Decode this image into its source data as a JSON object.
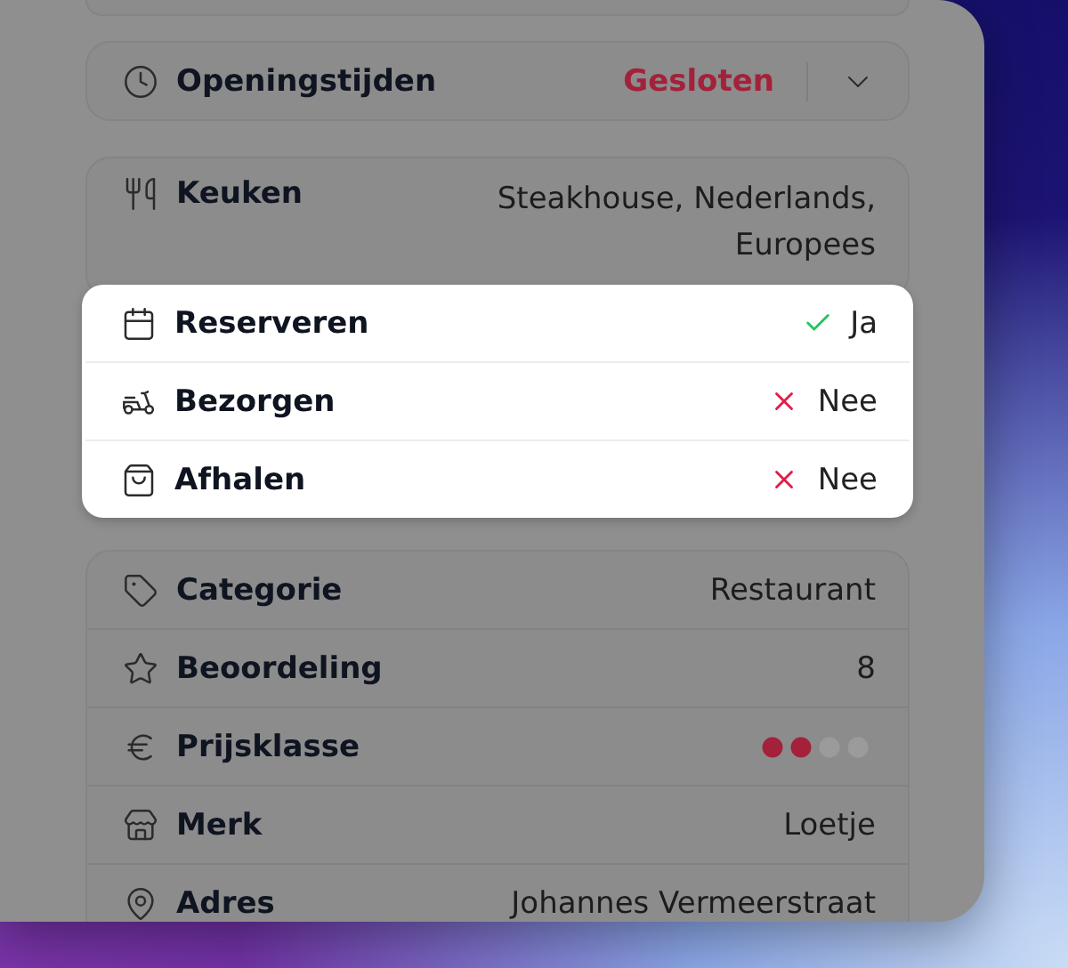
{
  "opening_hours": {
    "label": "Openingstijden",
    "status": "Gesloten",
    "expanded": false
  },
  "cuisine": {
    "label": "Keuken",
    "value": "Steakhouse, Nederlands, Europees"
  },
  "services": [
    {
      "label": "Reserveren",
      "available": true,
      "value": "Ja"
    },
    {
      "label": "Bezorgen",
      "available": false,
      "value": "Nee"
    },
    {
      "label": "Afhalen",
      "available": false,
      "value": "Nee"
    }
  ],
  "details": [
    {
      "kind": "text",
      "label": "Categorie",
      "value": "Restaurant"
    },
    {
      "kind": "text",
      "label": "Beoordeling",
      "value": "8"
    },
    {
      "kind": "price",
      "label": "Prijsklasse",
      "level": 0.5
    },
    {
      "kind": "text",
      "label": "Merk",
      "value": "Loetje"
    },
    {
      "kind": "text",
      "label": "Adres",
      "value": "Johannes Vermeerstraat"
    }
  ]
}
